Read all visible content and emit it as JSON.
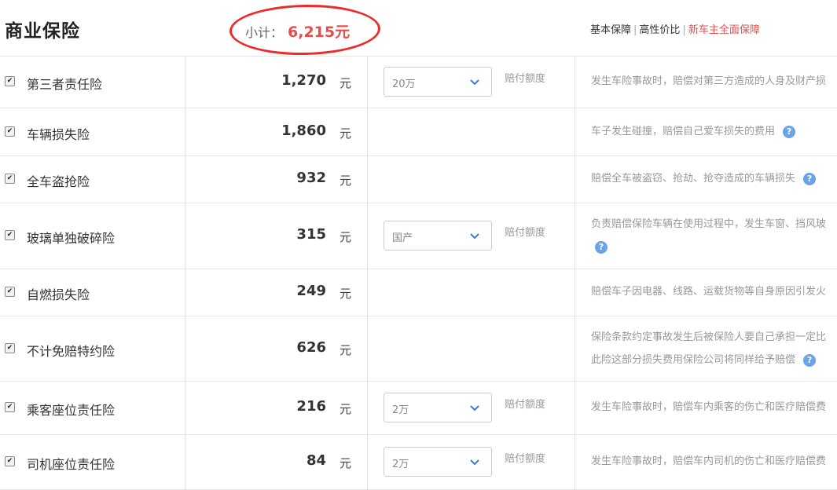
{
  "header": {
    "title": "商业保险",
    "subtotal_label": "小计：",
    "subtotal_value": "6,215",
    "subtotal_currency": "元",
    "links": [
      "基本保障",
      "高性价比",
      "新车主全面保障"
    ]
  },
  "common": {
    "unit": "元",
    "limit_label": "赔付额度"
  },
  "rows": [
    {
      "name": "第三者责任险",
      "price": "1,270",
      "select": "20万",
      "desc": [
        "发生车险事故时，赔偿对第三方造成的人身及财产损"
      ]
    },
    {
      "name": "车辆损失险",
      "price": "1,860",
      "desc": [
        "车子发生碰撞，赔偿自己爱车损失的费用"
      ],
      "help": true
    },
    {
      "name": "全车盗抢险",
      "price": "932",
      "desc": [
        "赔偿全车被盗窃、抢劫、抢夺造成的车辆损失"
      ],
      "help": true
    },
    {
      "name": "玻璃单独破碎险",
      "price": "315",
      "select": "国产",
      "desc": [
        "负责赔偿保险车辆在使用过程中，发生车窗、挡风玻"
      ],
      "help_below": true
    },
    {
      "name": "自燃损失险",
      "price": "249",
      "desc": [
        "赔偿车子因电器、线路、运载货物等自身原因引发火"
      ]
    },
    {
      "name": "不计免赔特约险",
      "price": "626",
      "desc": [
        "保险条款约定事故发生后被保险人要自己承担一定比",
        "此险这部分损失费用保险公司将同样给予赔偿"
      ],
      "help": true
    },
    {
      "name": "乘客座位责任险",
      "price": "216",
      "select": "2万",
      "desc": [
        "发生车险事故时，赔偿车内乘客的伤亡和医疗赔偿费"
      ]
    },
    {
      "name": "司机座位责任险",
      "price": "84",
      "select": "2万",
      "desc": [
        "发生车险事故时，赔偿车内司机的伤亡和医疗赔偿费"
      ]
    }
  ],
  "colors": {
    "accent_red": "#e94b4b",
    "help_blue": "#6aa3e8"
  }
}
